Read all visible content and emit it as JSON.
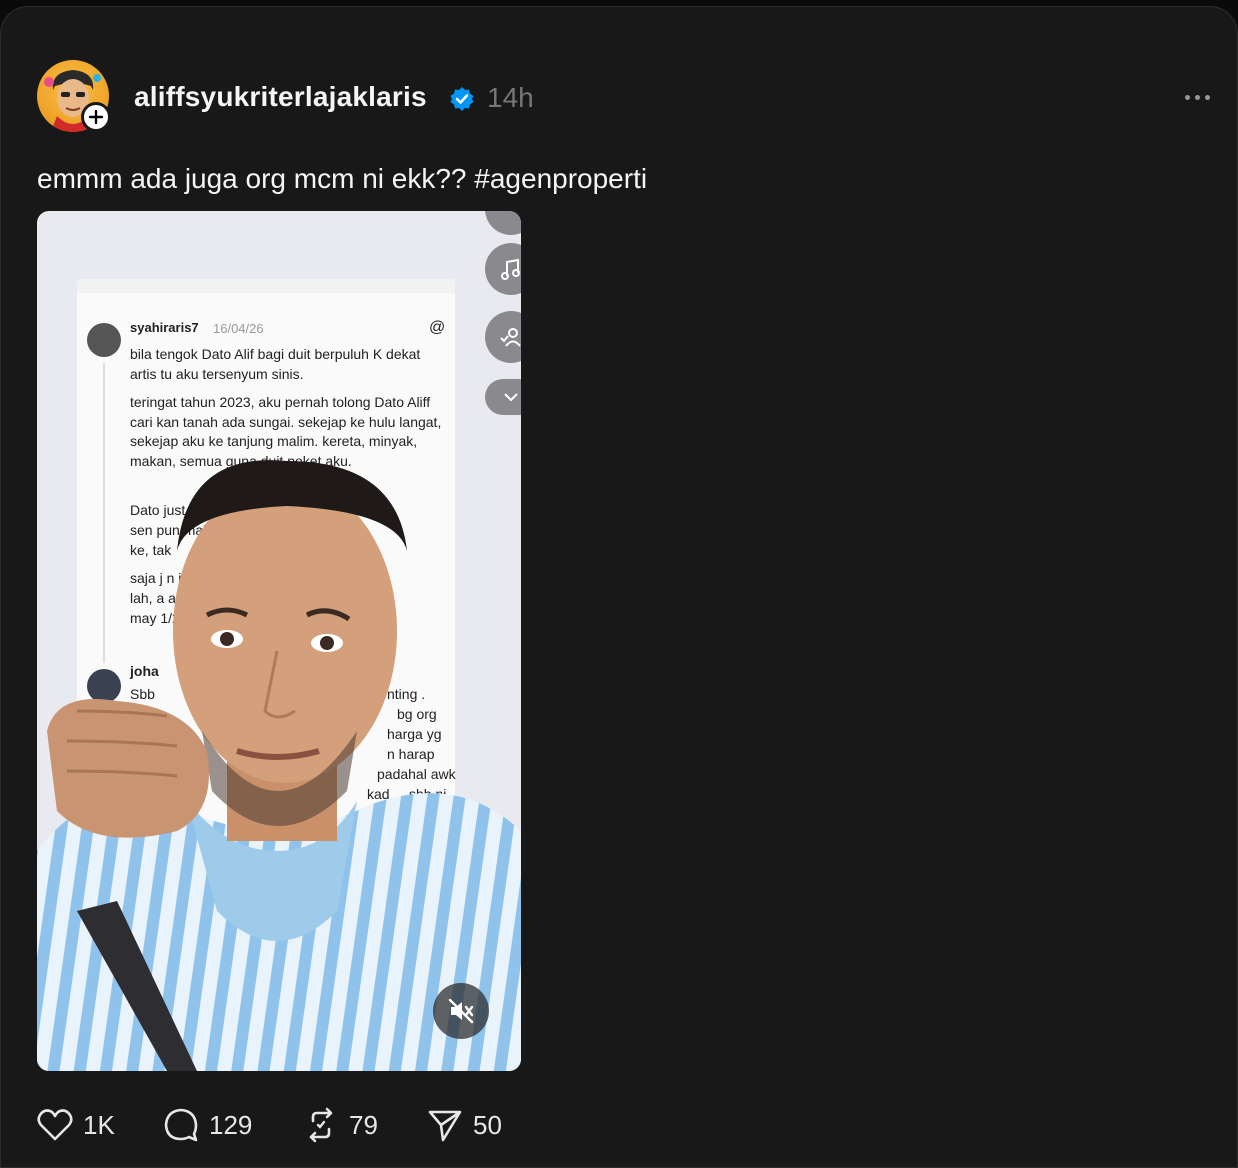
{
  "post": {
    "username": "aliffsyukriterlajaklaris",
    "time": "14h",
    "caption": "emmm ada juga org mcm ni ekk?? #agenproperti"
  },
  "media": {
    "screenshot": {
      "user": "syahiraris7",
      "date": "16/04/26",
      "p1": "bila tengok Dato Alif bagi duit berpuluh K dekat artis tu aku tersenyum sinis.",
      "p2": "teringat tahun 2023, aku pernah tolong Dato Aliff cari kan tanah ada sungai. sekejap ke hulu langat, sekejap aku ke tanjung malim. kereta, minyak, makan, semua guna duit poket aku.",
      "p3": "Dato just                              an aku. 1",
      "p3b": "sen pun                              makan",
      "p3c": "ke, tak",
      "p4": "saja j                                     n iye",
      "p4b": "lah, a                                    an.",
      "p4c": "may                                        1/2",
      "reply_user": "joha",
      "reply_line1": "Sbb",
      "reply_tail": [
        "nting .",
        "bg org",
        "harga yg",
        "n harap",
        "padahal awk",
        "kad ... sbb ni"
      ]
    }
  },
  "actions": {
    "likes": "1K",
    "comments": "129",
    "reposts": "79",
    "shares": "50"
  },
  "colors": {
    "background": "#181818",
    "verified": "#0095f6",
    "text": "#f3f5f7",
    "muted": "#777777"
  }
}
